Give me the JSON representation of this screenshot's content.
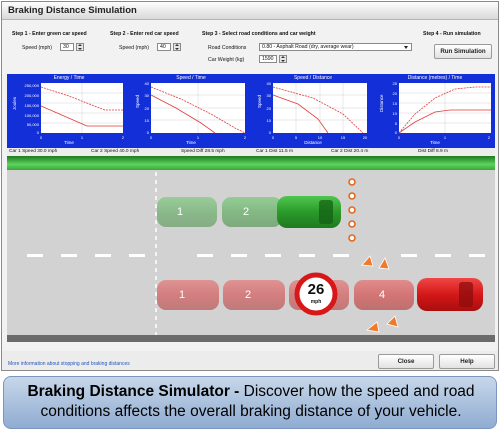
{
  "window": {
    "title": "Braking Distance Simulation"
  },
  "steps": {
    "step1": {
      "heading": "Step 1 - Enter green car speed",
      "label": "Speed (mph)",
      "value": "30"
    },
    "step2": {
      "heading": "Step 2 - Enter red car speed",
      "label": "Speed (mph)",
      "value": "40"
    },
    "step3": {
      "heading": "Step 3 - Select road conditions and car weight",
      "road_label": "Road Conditions",
      "road_value": "0.80 - Asphalt Road (dry, average wear)",
      "weight_label": "Car Weight (kg)",
      "weight_value": "1590"
    },
    "step4": {
      "heading": "Step 4 - Run simulation",
      "button": "Run Simulation"
    }
  },
  "graphs": [
    {
      "title": "Energy / Time",
      "ylabel": "Joules",
      "xlabel": "Time",
      "yticks": [
        "250,000",
        "200,000",
        "150,000",
        "100,000",
        "50,000",
        "0"
      ],
      "xticks": [
        "0",
        "1",
        "2"
      ]
    },
    {
      "title": "Speed / Time",
      "ylabel": "Speed",
      "xlabel": "Time",
      "yticks": [
        "40",
        "30",
        "20",
        "10",
        "0"
      ],
      "xticks": [
        "0",
        "1",
        "2"
      ]
    },
    {
      "title": "Speed / Distance",
      "ylabel": "Speed",
      "xlabel": "Distance",
      "yticks": [
        "40",
        "30",
        "20",
        "10",
        "0"
      ],
      "xticks": [
        "0",
        "5",
        "10",
        "15",
        "20"
      ]
    },
    {
      "title": "Distance (metres) / Time",
      "ylabel": "Distance",
      "xlabel": "Time",
      "yticks": [
        "25",
        "20",
        "15",
        "10",
        "5",
        "0"
      ],
      "xticks": [
        "0",
        "1",
        "2"
      ]
    }
  ],
  "stats": {
    "car1_speed": "Car 1 Speed 30.0 mph",
    "car2_speed": "Car 2 Speed 40.0 mph",
    "speed_diff": "Speed Diff 28.5 mph",
    "car1_dist": "Car 1 Dist 11.5 m",
    "car2_dist": "Car 2 Dist 20.4 m",
    "dist_diff": "Dist Diff 8.9 m"
  },
  "road": {
    "green_car_labels": [
      "1",
      "2"
    ],
    "red_car_labels": [
      "1",
      "2",
      "4"
    ],
    "speed_sign": {
      "value": "26",
      "unit": "mph"
    }
  },
  "footer": {
    "info_link": "More information about stopping and braking distances",
    "close": "Close",
    "help": "Help"
  },
  "caption": {
    "bold": "Braking Distance Simulator -",
    "text": " Discover how the speed and road conditions affects the overall braking distance of your vehicle."
  },
  "colors": {
    "graph_bg": "#1330d8",
    "green_car": "#2fa22f",
    "red_car": "#d91c1c",
    "sign_ring": "#d81818"
  }
}
